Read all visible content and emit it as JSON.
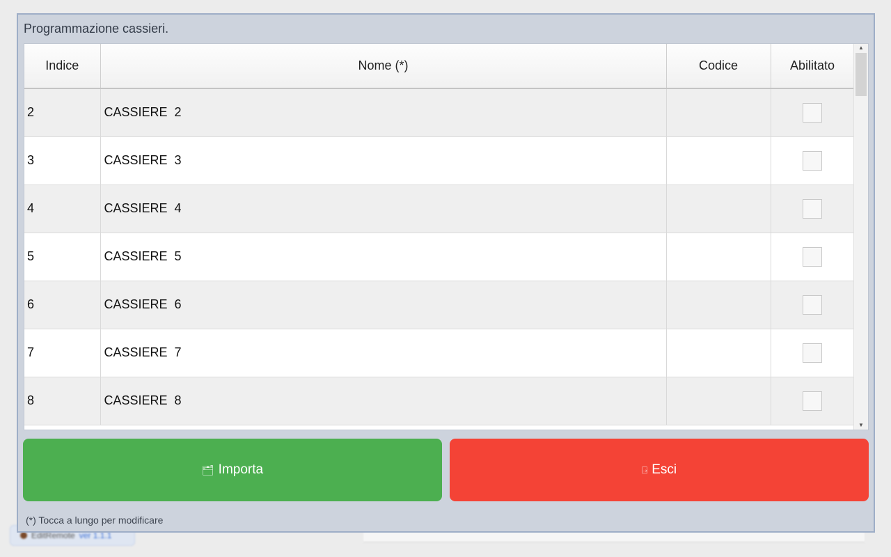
{
  "background": {
    "app_name": "EditRemote",
    "app_version": "ver 1.1.1"
  },
  "dialog": {
    "title": "Programmazione cassieri.",
    "columns": [
      "Indice",
      "Nome (*)",
      "Codice",
      "Abilitato"
    ],
    "rows": [
      {
        "index": "2",
        "name": "CASSIERE  2",
        "code": "",
        "enabled": false
      },
      {
        "index": "3",
        "name": "CASSIERE  3",
        "code": "",
        "enabled": false
      },
      {
        "index": "4",
        "name": "CASSIERE  4",
        "code": "",
        "enabled": false
      },
      {
        "index": "5",
        "name": "CASSIERE  5",
        "code": "",
        "enabled": false
      },
      {
        "index": "6",
        "name": "CASSIERE  6",
        "code": "",
        "enabled": false
      },
      {
        "index": "7",
        "name": "CASSIERE  7",
        "code": "",
        "enabled": false
      },
      {
        "index": "8",
        "name": "CASSIERE  8",
        "code": "",
        "enabled": false
      }
    ],
    "buttons": {
      "import_label": "Importa",
      "import_icon": "folder-icon",
      "exit_label": "Esci",
      "exit_icon": "exit-door-icon"
    },
    "footnote": "(*) Tocca a lungo per modificare"
  },
  "colors": {
    "import_button": "#4caf50",
    "exit_button": "#f44336",
    "dialog_bg": "#cdd3dd"
  }
}
